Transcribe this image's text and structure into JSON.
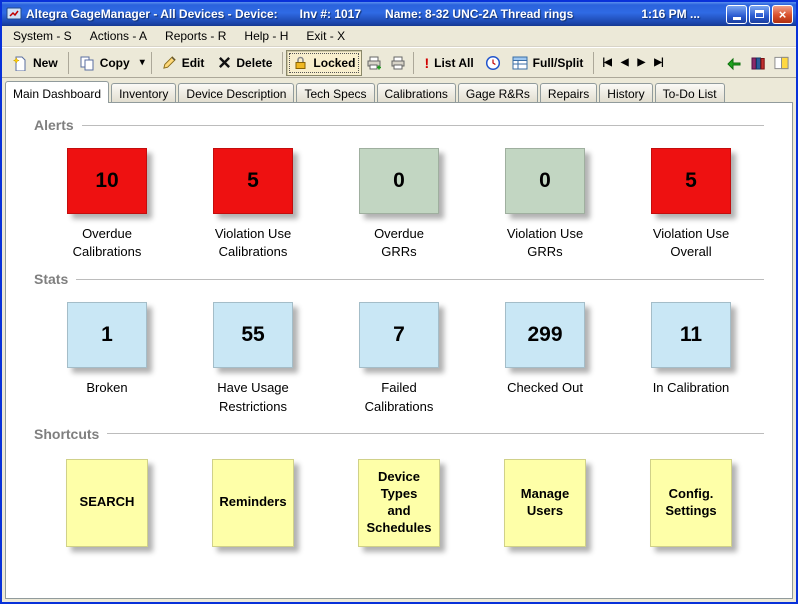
{
  "colors": {
    "alert-red": "#ee1111",
    "alert-green": "#c2d6c2",
    "stat-blue": "#c9e7f5",
    "shortcut-yellow": "#feffa8"
  },
  "titlebar": {
    "title": "Altegra GageManager - All Devices - Device:",
    "inv_no": "Inv #: 1017",
    "device_name": "Name: 8-32 UNC-2A Thread rings",
    "time": "1:16 PM ...",
    "close_glyph": "×"
  },
  "menubar": {
    "items": [
      {
        "label": "System - S"
      },
      {
        "label": "Actions - A"
      },
      {
        "label": "Reports - R"
      },
      {
        "label": "Help - H"
      },
      {
        "label": "Exit - X"
      }
    ]
  },
  "toolbar": {
    "new_label": "New",
    "copy_label": "Copy",
    "copy_dropdown_glyph": "▾",
    "edit_label": "Edit",
    "delete_label": "Delete",
    "locked_label": "Locked",
    "list_all_label": "List All",
    "list_all_badge": "!",
    "full_split_label": "Full/Split",
    "nav_first_glyph": "|◀",
    "nav_prev_glyph": "◀",
    "nav_next_glyph": "▶",
    "nav_last_glyph": "▶|"
  },
  "tabs": [
    {
      "label": "Main Dashboard"
    },
    {
      "label": "Inventory"
    },
    {
      "label": "Device Description"
    },
    {
      "label": "Tech Specs"
    },
    {
      "label": "Calibrations"
    },
    {
      "label": "Gage R&Rs"
    },
    {
      "label": "Repairs"
    },
    {
      "label": "History"
    },
    {
      "label": "To-Do List"
    }
  ],
  "dashboard": {
    "alerts": {
      "title": "Alerts",
      "tiles": [
        {
          "value": "10",
          "label": "Overdue\nCalibrations",
          "state": "red"
        },
        {
          "value": "5",
          "label": "Violation Use\nCalibrations",
          "state": "red"
        },
        {
          "value": "0",
          "label": "Overdue\nGRRs",
          "state": "green"
        },
        {
          "value": "0",
          "label": "Violation Use\nGRRs",
          "state": "green"
        },
        {
          "value": "5",
          "label": "Violation Use\nOverall",
          "state": "red"
        }
      ]
    },
    "stats": {
      "title": "Stats",
      "tiles": [
        {
          "value": "1",
          "label": "Broken"
        },
        {
          "value": "55",
          "label": "Have Usage\nRestrictions"
        },
        {
          "value": "7",
          "label": "Failed\nCalibrations"
        },
        {
          "value": "299",
          "label": "Checked Out"
        },
        {
          "value": "11",
          "label": "In Calibration"
        }
      ]
    },
    "shortcuts": {
      "title": "Shortcuts",
      "buttons": [
        {
          "label": "SEARCH"
        },
        {
          "label": "Reminders"
        },
        {
          "label": "Device\nTypes\nand\nSchedules"
        },
        {
          "label": "Manage\nUsers"
        },
        {
          "label": "Config.\nSettings"
        }
      ]
    }
  }
}
